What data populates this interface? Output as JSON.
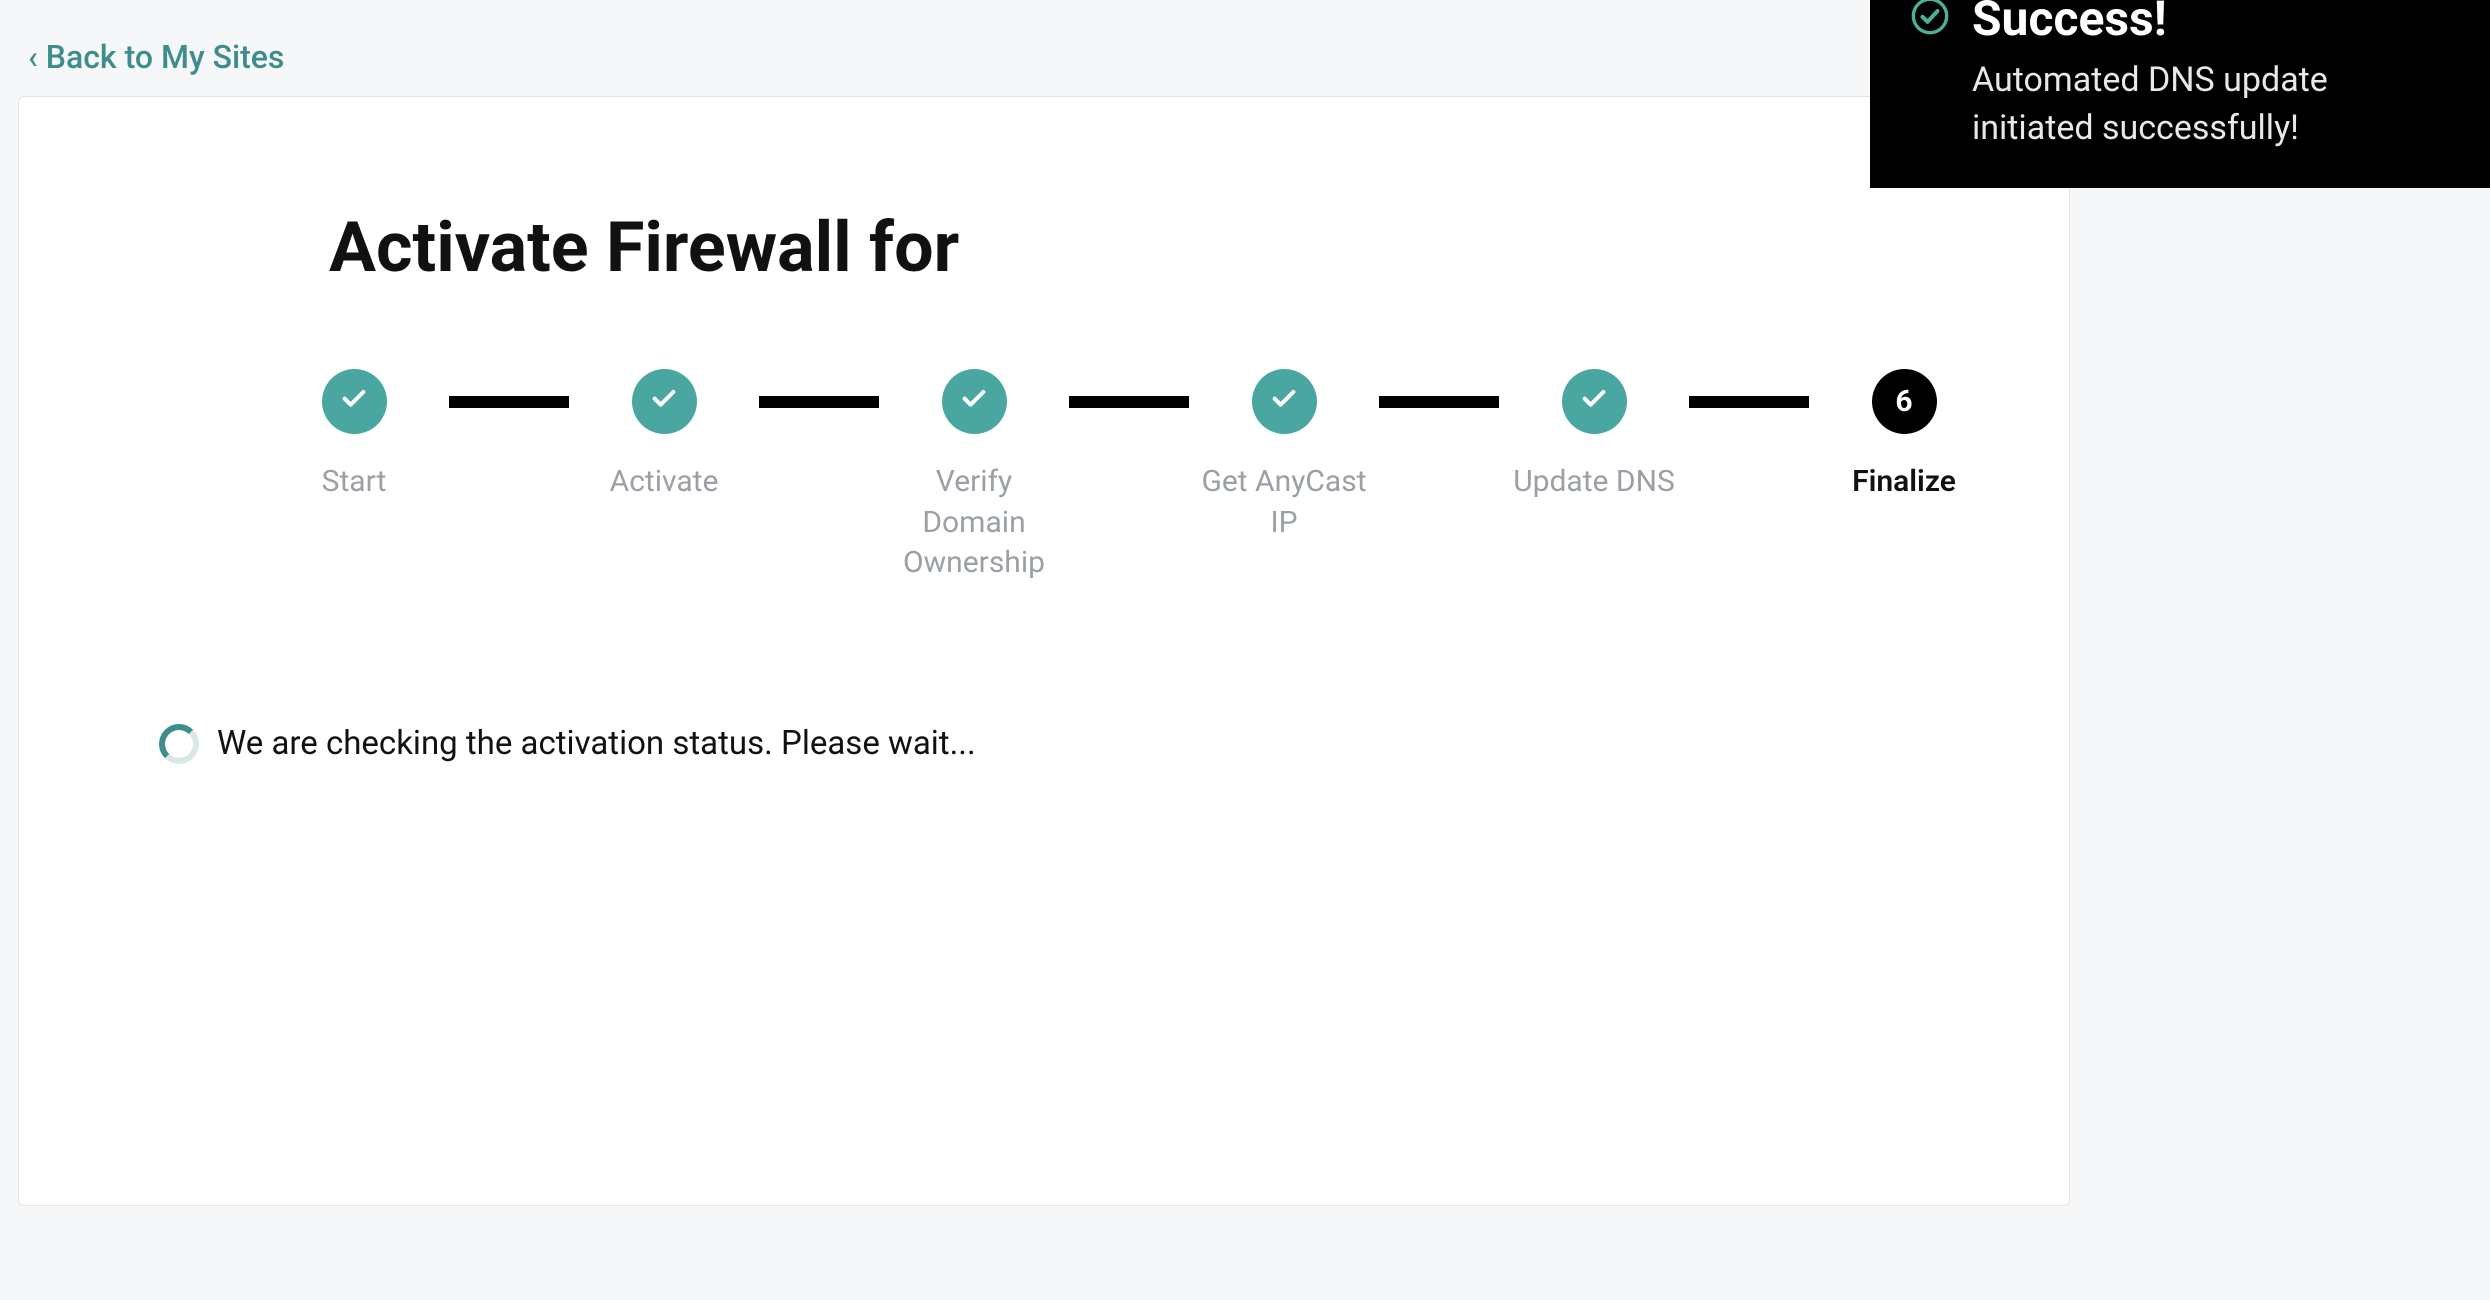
{
  "nav": {
    "back_label": "‹ Back to My Sites"
  },
  "page": {
    "title": "Activate Firewall for"
  },
  "stepper": {
    "steps": [
      {
        "label": "Start",
        "state": "done"
      },
      {
        "label": "Activate",
        "state": "done"
      },
      {
        "label": "Verify Domain Ownership",
        "state": "done"
      },
      {
        "label": "Get AnyCast IP",
        "state": "done"
      },
      {
        "label": "Update DNS",
        "state": "done"
      },
      {
        "label": "Finalize",
        "state": "current",
        "number": "6"
      }
    ]
  },
  "status": {
    "text": "We are checking the activation status. Please wait..."
  },
  "toast": {
    "title": "Success!",
    "message": "Automated DNS update initiated successfully!",
    "icon": "check-outline"
  },
  "colors": {
    "accent": "#3c8d8b",
    "step_done": "#4aa6a0",
    "step_current": "#000000",
    "page_bg": "#f5f7f8"
  }
}
